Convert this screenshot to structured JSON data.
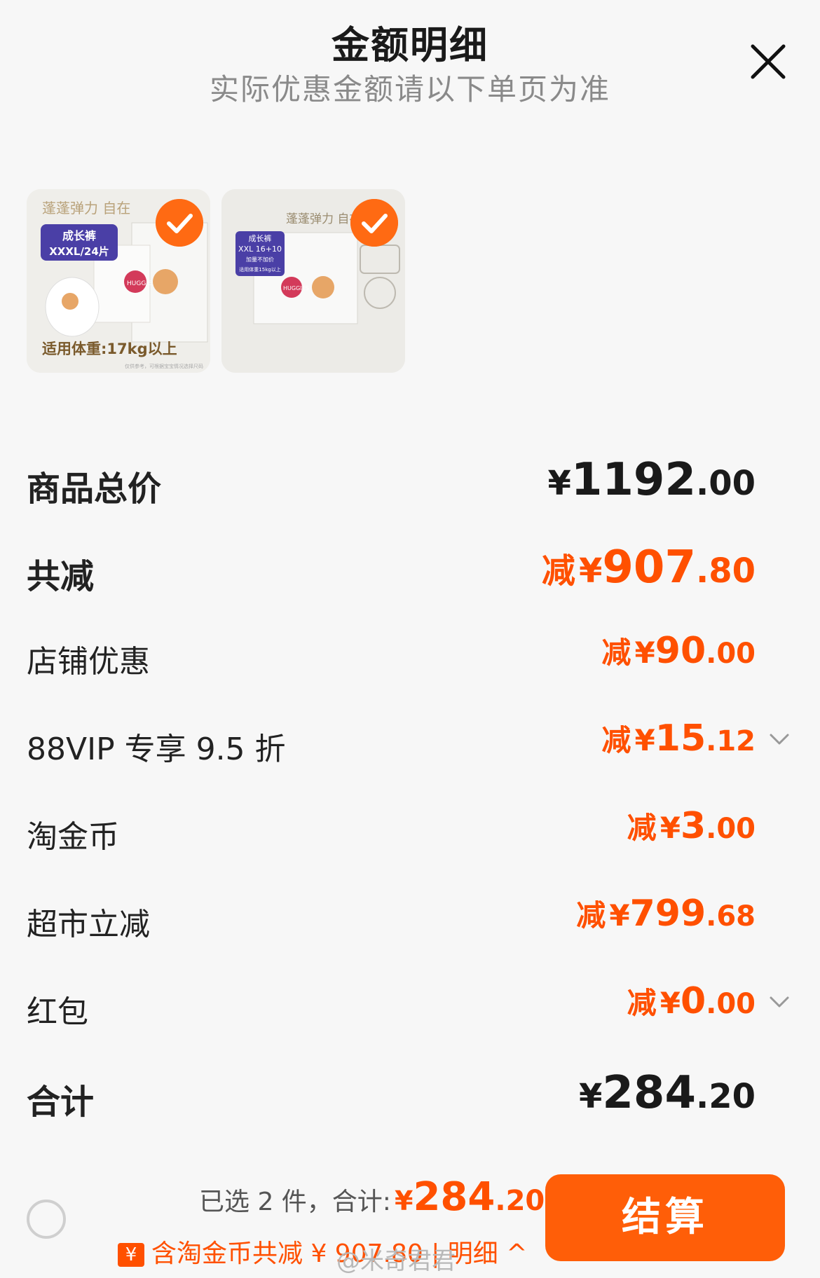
{
  "header": {
    "title": "金额明细",
    "subtitle": "实际优惠金额请以下单页为准"
  },
  "products": [
    {
      "slogan": "蓬蓬弹力 自在",
      "badge_line1": "成长裤",
      "badge_line2": "XXXL/24片",
      "weight_label": "适用体重:17kg以上",
      "fine_print": "仅供参考，可根据宝宝情况选择尺码",
      "brand": "HUGGIES",
      "selected": true
    },
    {
      "slogan": "蓬蓬弹力 自在随心",
      "badge_line1": "成长裤",
      "badge_line2": "XXL 16+10",
      "badge_line3": "加量不加价",
      "badge_line4": "适用体重15kg以上",
      "brand": "HUGGIES",
      "selected": true
    }
  ],
  "rows": [
    {
      "label": "商品总价",
      "prefix": "",
      "yen": "¥",
      "int": "1192",
      "dec": ".00",
      "style": "total",
      "chevron": false
    },
    {
      "label": "共减",
      "prefix": "减",
      "yen": "¥",
      "int": "907",
      "dec": ".80",
      "style": "total-orange",
      "chevron": false
    },
    {
      "label": "店铺优惠",
      "prefix": "减",
      "yen": "¥",
      "int": "90",
      "dec": ".00",
      "style": "detail",
      "chevron": false
    },
    {
      "label": "88VIP 专享 9.5 折",
      "prefix": "减",
      "yen": "¥",
      "int": "15",
      "dec": ".12",
      "style": "detail",
      "chevron": true
    },
    {
      "label": "淘金币",
      "prefix": "减",
      "yen": "¥",
      "int": "3",
      "dec": ".00",
      "style": "detail",
      "chevron": false
    },
    {
      "label": "超市立减",
      "prefix": "减",
      "yen": "¥",
      "int": "799",
      "dec": ".68",
      "style": "detail",
      "chevron": false
    },
    {
      "label": "红包",
      "prefix": "减",
      "yen": "¥",
      "int": "0",
      "dec": ".00",
      "style": "detail",
      "chevron": true
    },
    {
      "label": "合计",
      "prefix": "",
      "yen": "¥",
      "int": "284",
      "dec": ".20",
      "style": "total",
      "chevron": false
    }
  ],
  "footer": {
    "selected_text": "已选 2 件，合计:",
    "currency": "¥",
    "total_int": "284",
    "total_dec": ".20",
    "coupon_icon": "¥",
    "savings_text": "含淘金币共减 ¥ 907.80 | 明细 ^",
    "checkout_label": "结算",
    "watermark": "@米奇君君"
  },
  "colors": {
    "accent": "#ff5000",
    "checkout_bg": "#ff5e08",
    "background": "#f7f7f7"
  },
  "icons": [
    "close-icon",
    "check-icon",
    "chevron-down-icon",
    "coupon-icon",
    "radio-icon"
  ]
}
